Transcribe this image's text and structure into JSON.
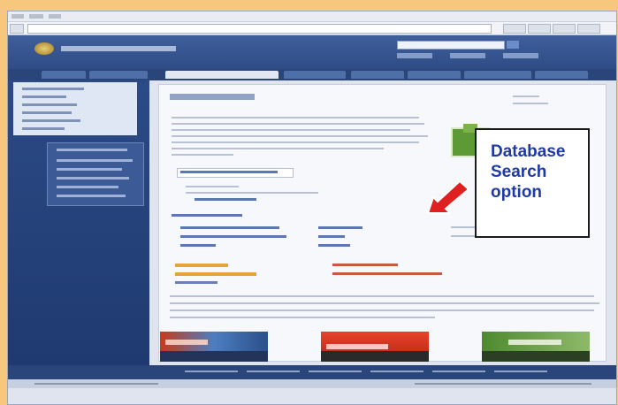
{
  "callout": {
    "lines": [
      "Database",
      "Search",
      "option"
    ]
  },
  "colors": {
    "callout_text": "#1f3aa6",
    "arrow": "#e02020",
    "page_bg": "#f6c77d",
    "site_header": "#2f4c86"
  },
  "icons": {
    "arrow": "arrow-pointing-left-icon",
    "logo": "seal-logo-icon"
  }
}
